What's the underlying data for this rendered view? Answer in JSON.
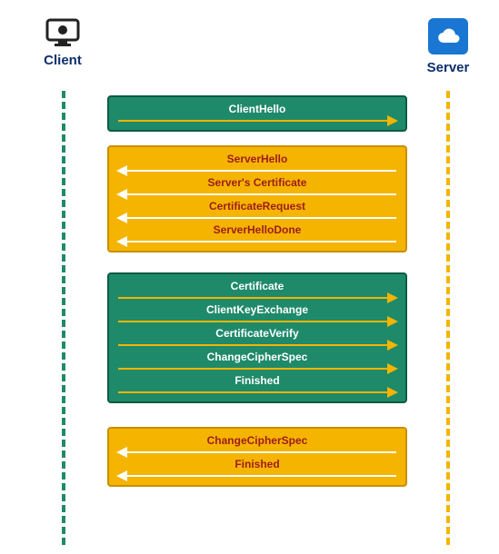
{
  "endpoints": {
    "client_label": "Client",
    "server_label": "Server"
  },
  "groups": [
    {
      "from": "client",
      "messages": [
        "ClientHello"
      ]
    },
    {
      "from": "server",
      "messages": [
        "ServerHello",
        "Server's Certificate",
        "CertificateRequest",
        "ServerHelloDone"
      ]
    },
    {
      "from": "client",
      "messages": [
        "Certificate",
        "ClientKeyExchange",
        "CertificateVerify",
        "ChangeCipherSpec",
        "Finished"
      ]
    },
    {
      "from": "server",
      "messages": [
        "ChangeCipherSpec",
        "Finished"
      ]
    }
  ]
}
